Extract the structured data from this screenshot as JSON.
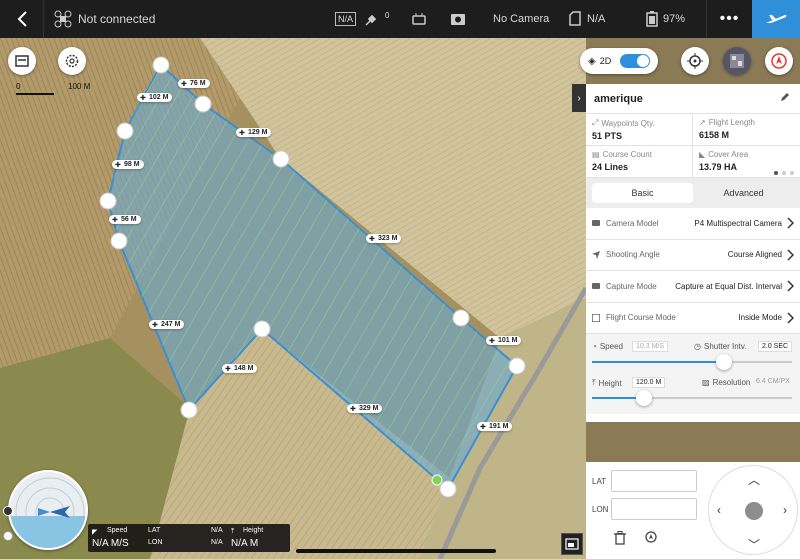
{
  "topbar": {
    "back_icon": "chevron-left-icon",
    "connection_status": "Not connected",
    "rc_mode": "N/A",
    "gps_count": "0",
    "camera_status": "No Camera",
    "storage": "N/A",
    "battery": "97%",
    "menu_label": "•••"
  },
  "map": {
    "scale_start": "0",
    "scale_end": "100 M",
    "view_mode": "2D",
    "segments": [
      {
        "label": "76 M"
      },
      {
        "label": "102 M"
      },
      {
        "label": "129 M"
      },
      {
        "label": "98 M"
      },
      {
        "label": "56 M"
      },
      {
        "label": "323 M"
      },
      {
        "label": "247 M"
      },
      {
        "label": "101 M"
      },
      {
        "label": "148 M"
      },
      {
        "label": "329 M"
      },
      {
        "label": "191 M"
      }
    ],
    "colors": {
      "area": "#6aaad0",
      "outline": "#3a8fd0",
      "course": "#8ee38a"
    }
  },
  "panel": {
    "mission_name": "amerique",
    "stats": [
      {
        "label": "Waypoints Qty.",
        "value": "51 PTS"
      },
      {
        "label": "Flight Length",
        "value": "6158 M"
      },
      {
        "label": "Course Count",
        "value": "24 Lines"
      },
      {
        "label": "Cover Area",
        "value": "13.79 HA"
      }
    ],
    "tabs": [
      {
        "label": "Basic"
      },
      {
        "label": "Advanced"
      }
    ],
    "rows": [
      {
        "label": "Camera Model",
        "value": "P4 Multispectral Camera"
      },
      {
        "label": "Shooting Angle",
        "value": "Course Aligned"
      },
      {
        "label": "Capture Mode",
        "value": "Capture at Equal Dist. Interval"
      },
      {
        "label": "Flight Course Mode",
        "value": "Inside Mode"
      }
    ],
    "speed": {
      "label": "Speed",
      "value": "10.3 M/S",
      "level": 0.66
    },
    "shutter": {
      "label": "Shutter Intv.",
      "value": "2.0 SEC"
    },
    "height": {
      "label": "Height",
      "value": "120.0 M",
      "level": 0.26
    },
    "resolution": {
      "label": "Resolution",
      "value": "6.4 CM/PX"
    }
  },
  "coords": {
    "lat_label": "LAT",
    "lon_label": "LON",
    "lat_value": "",
    "lon_value": ""
  },
  "telemetry": {
    "speed_label": "Speed",
    "speed_value": "N/A M/S",
    "lat_label": "LAT",
    "lat_value": "N/A",
    "lon_label": "LON",
    "lon_value": "N/A",
    "height_label": "Height",
    "height_value": "N/A M"
  }
}
